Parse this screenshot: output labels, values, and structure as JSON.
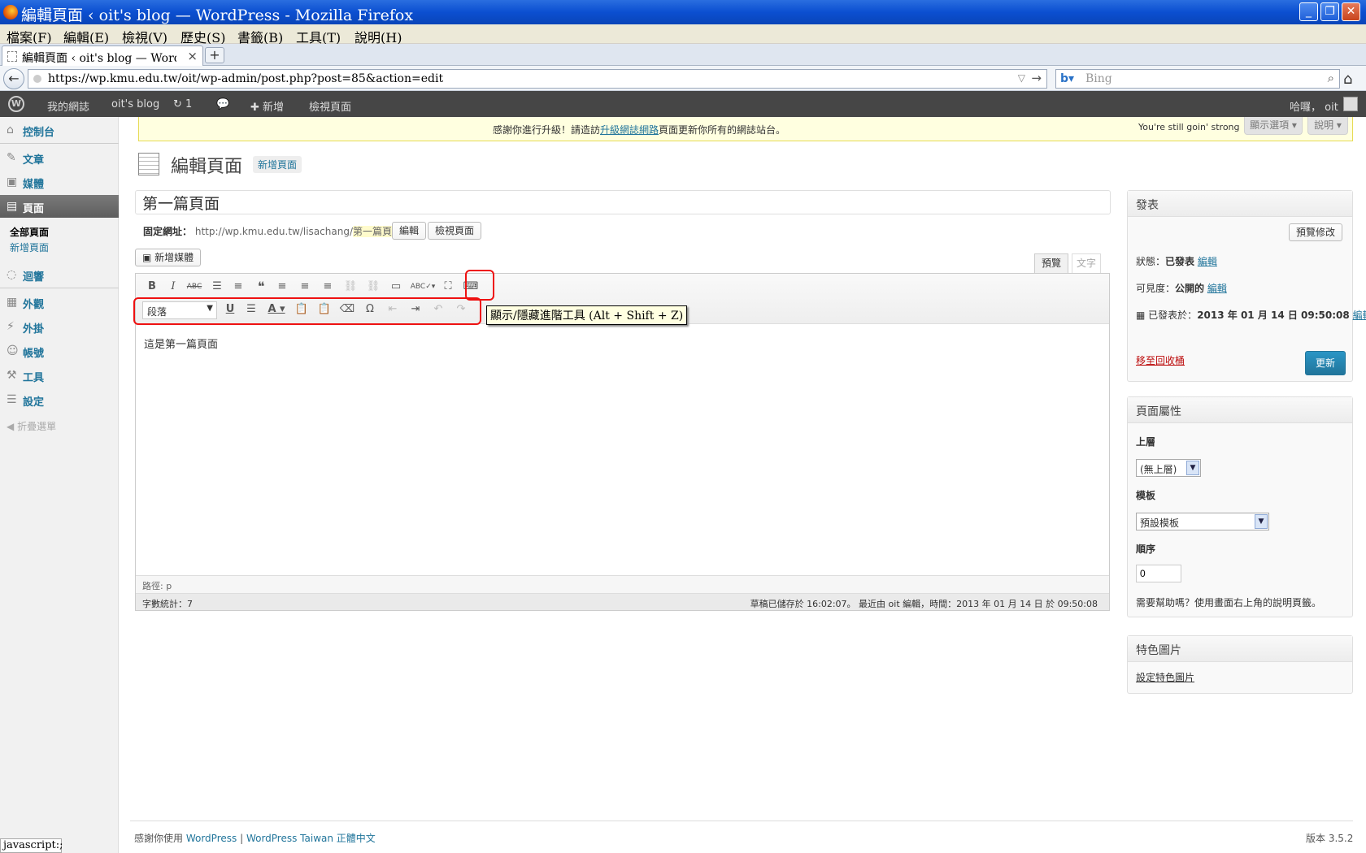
{
  "window": {
    "title": "編輯頁面 ‹ oit's blog — WordPress - Mozilla Firefox"
  },
  "menubar": [
    "檔案(F)",
    "編輯(E)",
    "檢視(V)",
    "歷史(S)",
    "書籤(B)",
    "工具(T)",
    "說明(H)"
  ],
  "tab": {
    "label": "編輯頁面 ‹ oit's blog — WordP…"
  },
  "nav": {
    "url": "https://wp.kmu.edu.tw/oit/wp-admin/post.php?post=85&action=edit",
    "search_placeholder": "Bing"
  },
  "adminbar": {
    "my_sites": "我的網誌",
    "blog": "oit's blog",
    "updates": "1",
    "new": "新增",
    "view_page": "檢視頁面",
    "greeting": "哈囉， oit"
  },
  "sidebar": {
    "dashboard": "控制台",
    "posts": "文章",
    "media": "媒體",
    "pages": "頁面",
    "all_pages": "全部頁面",
    "add_new": "新增頁面",
    "comments": "迴響",
    "appearance": "外觀",
    "plugins": "外掛",
    "users": "帳號",
    "tools": "工具",
    "settings": "設定",
    "collapse": "折疊選單"
  },
  "notice": {
    "pre": "感謝你進行升級！請造訪",
    "link": "升級網誌網路",
    "post": "頁面更新你所有的網誌站台。",
    "still": "You're still goin' strong",
    "screen_options": "顯示選項",
    "help": "說明"
  },
  "header": {
    "title": "編輯頁面",
    "add_new": "新增頁面"
  },
  "post": {
    "title": "第一篇頁面",
    "permalink_label": "固定網址：",
    "permalink_base": "http://wp.kmu.edu.tw/lisachang/",
    "permalink_slug": "第一篇頁面",
    "permalink_end": "/",
    "edit_btn": "編輯",
    "view_btn": "檢視頁面",
    "add_media": "新增媒體",
    "tab_visual": "預覽",
    "tab_text": "文字",
    "format": "段落",
    "content": "這是第一篇頁面",
    "tooltip": "顯示/隱藏進階工具 (Alt + Shift + Z)",
    "path": "路徑: p",
    "word_count": "字數統計：7",
    "autosave": "草稿已儲存於 16:02:07。 最近由 oit 編輯，時間：2013 年 01 月 14 日 於 09:50:08"
  },
  "publish": {
    "title": "發表",
    "preview": "預覽修改",
    "status_label": "狀態：",
    "status_value": "已發表",
    "visibility_label": "可見度：",
    "visibility_value": "公開的",
    "edit": "編輯",
    "published_label": "已發表於：",
    "published_value": "2013 年 01 月 14 日 09:50:08",
    "trash": "移至回收桶",
    "update": "更新"
  },
  "attributes": {
    "title": "頁面屬性",
    "parent_label": "上層",
    "parent_value": "(無上層)",
    "template_label": "模板",
    "template_value": "預設模板",
    "order_label": "順序",
    "order_value": "0",
    "help": "需要幫助嗎？使用畫面右上角的說明頁籤。"
  },
  "featured": {
    "title": "特色圖片",
    "set": "設定特色圖片"
  },
  "footer": {
    "thanks": "感謝你使用 ",
    "wp": "WordPress",
    "sep": " | ",
    "wp_tw": "WordPress Taiwan 正體中文",
    "version": "版本 3.5.2"
  },
  "statusline": "javascript:;"
}
